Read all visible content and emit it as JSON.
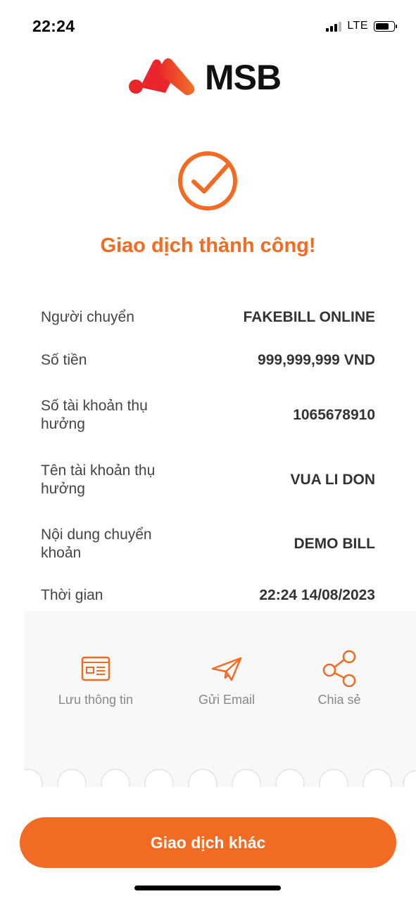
{
  "status_bar": {
    "time": "22:24",
    "network": "LTE",
    "battery_level": 0.75
  },
  "logo": {
    "text": "MSB"
  },
  "result": {
    "title": "Giao dịch thành công!"
  },
  "details": [
    {
      "label": "Người chuyển",
      "value": "FAKEBILL ONLINE"
    },
    {
      "label": "Số tiền",
      "value": "999,999,999 VND"
    },
    {
      "label": "Số tài khoản thụ hưởng",
      "value": "1065678910"
    },
    {
      "label": "Tên tài khoản thụ hưởng",
      "value": "VUA LI DON"
    },
    {
      "label": "Nội dung chuyển khoản",
      "value": "DEMO BILL"
    },
    {
      "label": "Thời gian",
      "value": "22:24 14/08/2023"
    }
  ],
  "actions": [
    {
      "label": "Lưu thông tin",
      "icon": "id-card-icon"
    },
    {
      "label": "Gửi Email",
      "icon": "paper-plane-icon"
    },
    {
      "label": "Chia sẻ",
      "icon": "share-icon"
    }
  ],
  "cta": {
    "label": "Giao dịch khác"
  },
  "colors": {
    "accent": "#f26b22",
    "logo_red": "#e8262b"
  }
}
